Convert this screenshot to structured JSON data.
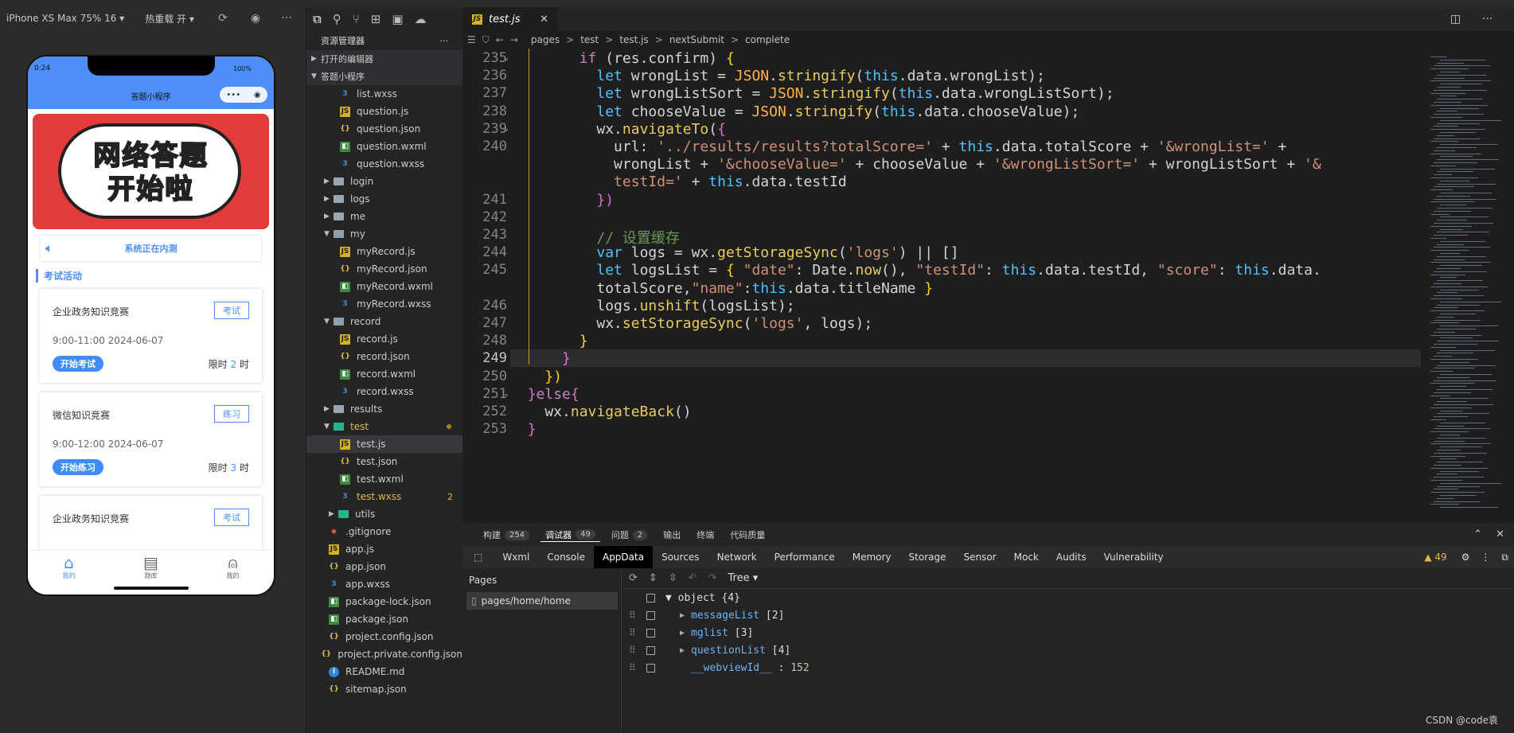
{
  "simulator": {
    "device": "iPhone XS Max 75% 16 ▾",
    "hot_reload": "热重载 开 ▾",
    "status_time": "0:24",
    "status_battery": "100%",
    "nav_title": "答题小程序",
    "banner_line1": "网络答题",
    "banner_line2": "开始啦",
    "notice_text": "系统正在内测",
    "section_title": "考试活动",
    "cards": [
      {
        "name": "企业政务知识竞赛",
        "tag": "考试",
        "time": "9:00-11:00 2024-06-07",
        "button": "开始考试",
        "limit_prefix": "限时",
        "limit_num": "2",
        "limit_suffix": "时"
      },
      {
        "name": "微信知识竞赛",
        "tag": "练习",
        "time": "9:00-12:00 2024-06-07",
        "button": "开始练习",
        "limit_prefix": "限时",
        "limit_num": "3",
        "limit_suffix": "时"
      },
      {
        "name": "企业政务知识竞赛",
        "tag": "考试"
      }
    ],
    "tabs": [
      {
        "label": "我的"
      },
      {
        "label": "题库"
      },
      {
        "label": "我的"
      }
    ]
  },
  "explorer": {
    "title": "资源管理器",
    "open_editors": "打开的编辑器",
    "project": "答题小程序",
    "files": [
      {
        "name": "list.wxss",
        "type": "wxss",
        "indent": 2
      },
      {
        "name": "question.js",
        "type": "js",
        "indent": 2
      },
      {
        "name": "question.json",
        "type": "json",
        "indent": 2
      },
      {
        "name": "question.wxml",
        "type": "wxml",
        "indent": 2
      },
      {
        "name": "question.wxss",
        "type": "wxss",
        "indent": 2
      },
      {
        "name": "login",
        "type": "folder",
        "indent": 1,
        "caret": "▶"
      },
      {
        "name": "logs",
        "type": "folder",
        "indent": 1,
        "caret": "▶"
      },
      {
        "name": "me",
        "type": "folder",
        "indent": 1,
        "caret": "▶"
      },
      {
        "name": "my",
        "type": "folder-open",
        "indent": 1,
        "caret": "▼"
      },
      {
        "name": "myRecord.js",
        "type": "js",
        "indent": 2
      },
      {
        "name": "myRecord.json",
        "type": "json",
        "indent": 2
      },
      {
        "name": "myRecord.wxml",
        "type": "wxml",
        "indent": 2
      },
      {
        "name": "myRecord.wxss",
        "type": "wxss",
        "indent": 2
      },
      {
        "name": "record",
        "type": "folder-open",
        "indent": 1,
        "caret": "▼"
      },
      {
        "name": "record.js",
        "type": "js",
        "indent": 2
      },
      {
        "name": "record.json",
        "type": "json",
        "indent": 2
      },
      {
        "name": "record.wxml",
        "type": "wxml",
        "indent": 2
      },
      {
        "name": "record.wxss",
        "type": "wxss",
        "indent": 2
      },
      {
        "name": "results",
        "type": "folder",
        "indent": 1,
        "caret": "▶"
      },
      {
        "name": "test",
        "type": "test",
        "indent": 1,
        "caret": "▼",
        "color": "#e0b84c",
        "dot": true
      },
      {
        "name": "test.js",
        "type": "js",
        "indent": 2,
        "selected": true
      },
      {
        "name": "test.json",
        "type": "json",
        "indent": 2
      },
      {
        "name": "test.wxml",
        "type": "wxml",
        "indent": 2
      },
      {
        "name": "test.wxss",
        "type": "wxss",
        "indent": 2,
        "color": "#e0b84c",
        "badge": "2"
      },
      {
        "name": "utils",
        "type": "test",
        "indent": 0,
        "caret": "▶"
      },
      {
        "name": ".gitignore",
        "type": "git",
        "indent": 0
      },
      {
        "name": "app.js",
        "type": "js",
        "indent": 0
      },
      {
        "name": "app.json",
        "type": "json",
        "indent": 0
      },
      {
        "name": "app.wxss",
        "type": "wxss",
        "indent": 0
      },
      {
        "name": "package-lock.json",
        "type": "wxml",
        "indent": 0
      },
      {
        "name": "package.json",
        "type": "wxml",
        "indent": 0
      },
      {
        "name": "project.config.json",
        "type": "json",
        "indent": 0
      },
      {
        "name": "project.private.config.json",
        "type": "json",
        "indent": 0
      },
      {
        "name": "README.md",
        "type": "info",
        "indent": 0
      },
      {
        "name": "sitemap.json",
        "type": "json",
        "indent": 0
      }
    ]
  },
  "editor": {
    "tab": "test.js",
    "breadcrumb": [
      "pages",
      ">",
      "test",
      ">",
      "test.js",
      ">",
      "nextSubmit",
      ">",
      "complete"
    ],
    "lines": [
      {
        "n": "235",
        "fold": true,
        "html": "        <span class='kw'>if</span> (res.confirm) <span class='p'>{</span>"
      },
      {
        "n": "236",
        "html": "          <span class='t'>let</span> wrongList = <span class='j'>JSON</span>.<span class='f'>stringify</span>(<span class='t'>this</span>.data.wrongList);"
      },
      {
        "n": "237",
        "html": "          <span class='t'>let</span> wrongListSort = <span class='j'>JSON</span>.<span class='f'>stringify</span>(<span class='t'>this</span>.data.wrongListSort);"
      },
      {
        "n": "238",
        "html": "          <span class='t'>let</span> chooseValue = <span class='j'>JSON</span>.<span class='f'>stringify</span>(<span class='t'>this</span>.data.chooseValue);"
      },
      {
        "n": "239",
        "fold": true,
        "html": "          wx.<span class='f'>navigateTo</span>(<span class='ps'>{</span>"
      },
      {
        "n": "240",
        "html": "            url: <span class='s'>'../results/results?totalScore='</span> + <span class='t'>this</span>.data.totalScore + <span class='s'>'&amp;wrongList='</span> +"
      },
      {
        "n": "",
        "html": "            wrongList + <span class='s'>'&amp;chooseValue='</span> + chooseValue + <span class='s'>'&amp;wrongListSort='</span> + wrongListSort + <span class='s'>'&amp;</span>"
      },
      {
        "n": "",
        "html": "            <span class='s'>testId='</span> + <span class='t'>this</span>.data.testId"
      },
      {
        "n": "241",
        "html": "          <span class='ps'>})</span>"
      },
      {
        "n": "242",
        "html": ""
      },
      {
        "n": "243",
        "html": "          <span class='c'>// 设置缓存</span>"
      },
      {
        "n": "244",
        "html": "          <span class='t'>var</span> logs = wx.<span class='f'>getStorageSync</span>(<span class='s'>'logs'</span>) || []"
      },
      {
        "n": "245",
        "html": "          <span class='t'>let</span> logsList = <span class='p'>{</span> <span class='s'>\"date\"</span>: Date.<span class='f'>now</span>(), <span class='s'>\"testId\"</span>: <span class='t'>this</span>.data.testId, <span class='s'>\"score\"</span>: <span class='t'>this</span>.data."
      },
      {
        "n": "",
        "html": "          totalScore,<span class='s'>\"name\"</span>:<span class='t'>this</span>.data.titleName <span class='p'>}</span>"
      },
      {
        "n": "246",
        "html": "          logs.<span class='f'>unshift</span>(logsList);"
      },
      {
        "n": "247",
        "html": "          wx.<span class='f'>setStorageSync</span>(<span class='s'>'logs'</span>, logs);"
      },
      {
        "n": "248",
        "html": "        <span class='p'>}</span>"
      },
      {
        "n": "249",
        "html": "      <span class='ps'>}</span>",
        "current": true
      },
      {
        "n": "250",
        "html": "    <span class='p'>})</span>"
      },
      {
        "n": "251",
        "fold": true,
        "html": "  <span class='ps'>}</span><span class='kw'>else</span><span class='ps'>{</span>"
      },
      {
        "n": "252",
        "html": "    wx.<span class='f'>navigateBack</span>()"
      },
      {
        "n": "253",
        "html": "  <span class='ps'>}</span>"
      }
    ]
  },
  "panel": {
    "tabs": [
      {
        "label": "构建",
        "count": "254"
      },
      {
        "label": "调试器",
        "count": "49",
        "active": true
      },
      {
        "label": "问题",
        "count": "2"
      },
      {
        "label": "输出"
      },
      {
        "label": "终端"
      },
      {
        "label": "代码质量"
      }
    ],
    "devtools_tabs": [
      "Wxml",
      "Console",
      "AppData",
      "Sources",
      "Network",
      "Performance",
      "Memory",
      "Storage",
      "Sensor",
      "Mock",
      "Audits",
      "Vulnerability"
    ],
    "active_devtool": "AppData",
    "warnings": "▲ 49",
    "pages_header": "Pages",
    "page_item": "pages/home/home",
    "view_mode": "Tree",
    "object_root": "object {4}",
    "object_rows": [
      {
        "key": "messageList",
        "val": "[2]",
        "caret": "▶"
      },
      {
        "key": "mglist",
        "val": "[3]",
        "caret": "▶"
      },
      {
        "key": "questionList",
        "val": "[4]",
        "caret": "▶"
      },
      {
        "key": "__webviewId__",
        "val": "152",
        "caret": ""
      }
    ],
    "watermark": "CSDN @code袁"
  }
}
